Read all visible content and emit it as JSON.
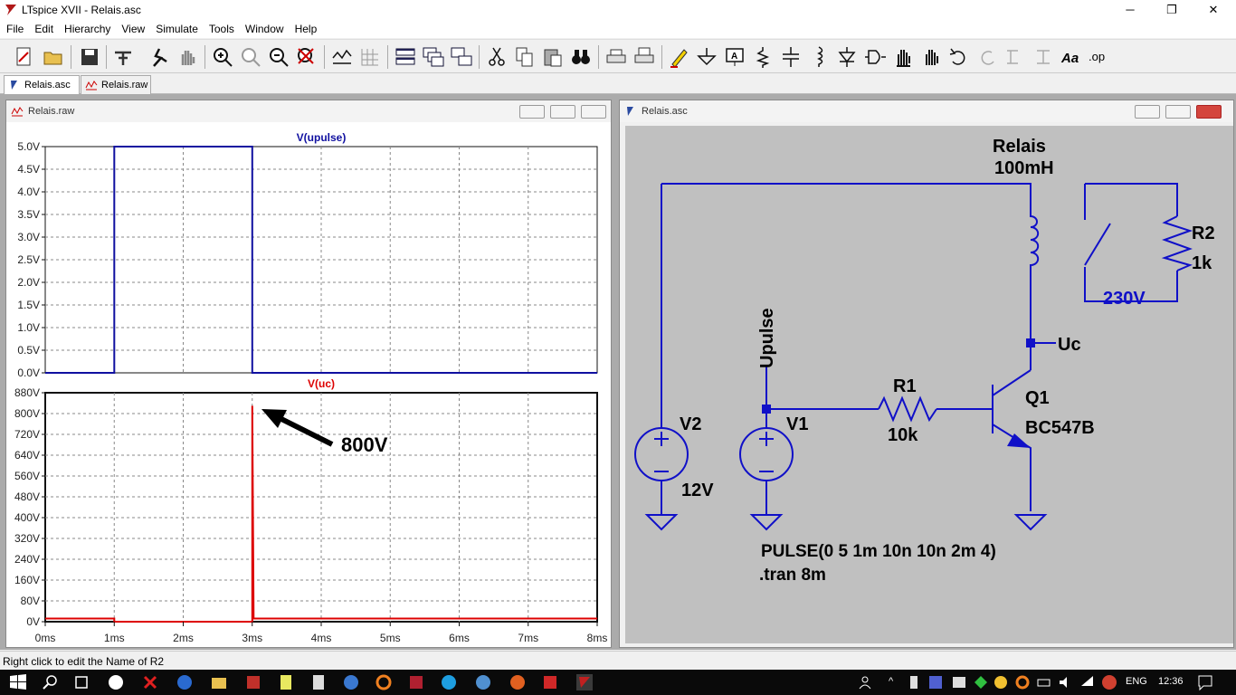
{
  "window": {
    "title": "LTspice XVII - Relais.asc",
    "minimize": "─",
    "maximize": "❐",
    "close": "✕"
  },
  "menu": [
    "File",
    "Edit",
    "Hierarchy",
    "View",
    "Simulate",
    "Tools",
    "Window",
    "Help"
  ],
  "tabs": [
    {
      "label": "Relais.asc"
    },
    {
      "label": "Relais.raw"
    }
  ],
  "waveform_window": {
    "title": "Relais.raw"
  },
  "schematic_window": {
    "title": "Relais.asc"
  },
  "chart_data": [
    {
      "type": "line",
      "title": "V(upulse)",
      "color": "#1010a0",
      "x": [
        0,
        1,
        1,
        3,
        3,
        8
      ],
      "y": [
        0,
        0,
        5,
        5,
        0,
        0
      ],
      "xticks": [
        "0ms",
        "1ms",
        "2ms",
        "3ms",
        "4ms",
        "5ms",
        "6ms",
        "7ms",
        "8ms"
      ],
      "yticks": [
        "0.0V",
        "0.5V",
        "1.0V",
        "1.5V",
        "2.0V",
        "2.5V",
        "3.0V",
        "3.5V",
        "4.0V",
        "4.5V",
        "5.0V"
      ],
      "ylim": [
        0,
        5
      ],
      "xlim": [
        0,
        8
      ],
      "grid": true
    },
    {
      "type": "line",
      "title": "V(uc)",
      "color": "#dd0000",
      "x": [
        0,
        1,
        1,
        3,
        3,
        3.02,
        3.04,
        8
      ],
      "y": [
        12,
        12,
        0,
        0,
        830,
        12,
        12,
        12
      ],
      "xticks": [
        "0ms",
        "1ms",
        "2ms",
        "3ms",
        "4ms",
        "5ms",
        "6ms",
        "7ms",
        "8ms"
      ],
      "yticks": [
        "0V",
        "80V",
        "160V",
        "240V",
        "320V",
        "400V",
        "480V",
        "560V",
        "640V",
        "720V",
        "800V",
        "880V"
      ],
      "ylim": [
        0,
        880
      ],
      "xlim": [
        0,
        8
      ],
      "grid": true,
      "annotation": "800V"
    }
  ],
  "schematic": {
    "relay_name": "Relais",
    "relay_value": "100mH",
    "r2_name": "R2",
    "r2_value": "1k",
    "mains_label": "230V",
    "uc_label": "Uc",
    "upulse_label": "Upulse",
    "r1_name": "R1",
    "r1_value": "10k",
    "q1_name": "Q1",
    "q1_model": "BC547B",
    "v2_name": "V2",
    "v2_value": "12V",
    "v1_name": "V1",
    "pulse_spec": "PULSE(0 5 1m 10n 10n 2m 4)",
    "tran": ".tran 8m"
  },
  "status": "Right click to edit the Name of R2",
  "tray": {
    "lang": "ENG",
    "time": "12:36"
  }
}
